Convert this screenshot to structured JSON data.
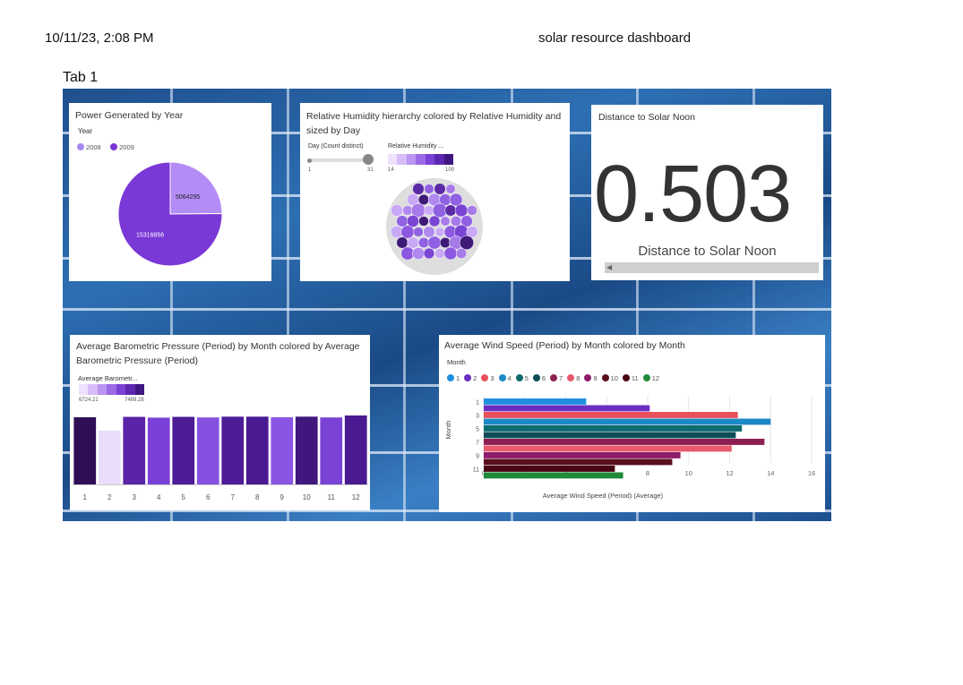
{
  "header": {
    "date": "10/11/23, 2:08 PM",
    "title": "solar resource dashboard"
  },
  "tab": {
    "label": "Tab 1"
  },
  "colors": {
    "purple_light": "#c9a7f5",
    "purple": "#8b4fdc",
    "purple_dark": "#3d1a6e"
  },
  "pie": {
    "title": "Power Generated by Year",
    "legend_title": "Year",
    "legend": [
      {
        "label": "2008",
        "color": "#a987f0"
      },
      {
        "label": "2009",
        "color": "#7a38d6"
      }
    ]
  },
  "bubble": {
    "title": "Relative Humidity hierarchy colored by Relative Humidity and sized by Day",
    "size_legend_title": "Day (Count distinct)",
    "size_min": "1",
    "size_max": "31",
    "color_legend_title": "Relative Humidity ...",
    "color_min": "14",
    "color_max": "100"
  },
  "kpi": {
    "title": "Distance to Solar Noon",
    "value": "0.503",
    "label": "Distance to Solar Noon"
  },
  "baro": {
    "title": "Average Barometric Pressure (Period) by Month colored by Average Barometric Pressure (Period)",
    "legend_title": "Average Barometr...",
    "legend_min": "6724.21",
    "legend_max": "7489.28"
  },
  "wind": {
    "title": "Average Wind Speed (Period) by Month colored by Month",
    "legend_title": "Month"
  },
  "chart_data": [
    {
      "type": "pie",
      "title": "Power Generated by Year",
      "categories": [
        "2008",
        "2009"
      ],
      "values": [
        5064295,
        15316856
      ],
      "colors": [
        "#b48cf6",
        "#7a38d6"
      ],
      "legend_position": "top-left"
    },
    {
      "type": "bubble",
      "title": "Relative Humidity hierarchy colored by Relative Humidity and sized by Day",
      "note_color_range": [
        14,
        100
      ],
      "size_range": [
        1,
        31
      ]
    },
    {
      "type": "bar",
      "title": "Average Barometric Pressure (Period) by Month colored by Average Barometric Pressure (Period)",
      "categories": [
        "1",
        "2",
        "3",
        "4",
        "5",
        "6",
        "7",
        "8",
        "9",
        "10",
        "11",
        "12"
      ],
      "values": [
        7400,
        6724.21,
        7420,
        7380,
        7420,
        7390,
        7430,
        7430,
        7400,
        7430,
        7390,
        7489.28
      ],
      "colors": [
        "#2e0f56",
        "#e9dcfb",
        "#5a23a8",
        "#7b40d8",
        "#4d1c97",
        "#8551e0",
        "#4d1c97",
        "#4a1a92",
        "#8a55e3",
        "#3f177d",
        "#7a43d6",
        "#4a1a92"
      ],
      "grid": false
    },
    {
      "type": "bar",
      "orientation": "horizontal",
      "title": "Average Wind Speed (Period) by Month colored by Month",
      "categories": [
        "1",
        "2",
        "3",
        "4",
        "5",
        "6",
        "7",
        "8",
        "9",
        "10",
        "11",
        "12"
      ],
      "tick_labels": [
        "1",
        "3",
        "5",
        "7",
        "9",
        "11"
      ],
      "values": [
        5.0,
        8.1,
        12.4,
        14.0,
        12.6,
        12.3,
        13.7,
        12.1,
        9.6,
        9.2,
        6.4,
        6.8
      ],
      "colors": [
        "#1f8fe0",
        "#6a2fc2",
        "#e8505b",
        "#1d88c6",
        "#0e6b6e",
        "#0b4e57",
        "#8e1f52",
        "#e85a6b",
        "#8e1c6a",
        "#5a0f1e",
        "#4a0512",
        "#1f8a3a"
      ],
      "xlabel": "Average Wind Speed (Period) (Average)",
      "ylabel": "Month",
      "xlim": [
        0,
        16
      ],
      "xticks": [
        0,
        2,
        4,
        6,
        8,
        10,
        12,
        14,
        16
      ],
      "grid": true,
      "legend_position": "top-left"
    }
  ]
}
